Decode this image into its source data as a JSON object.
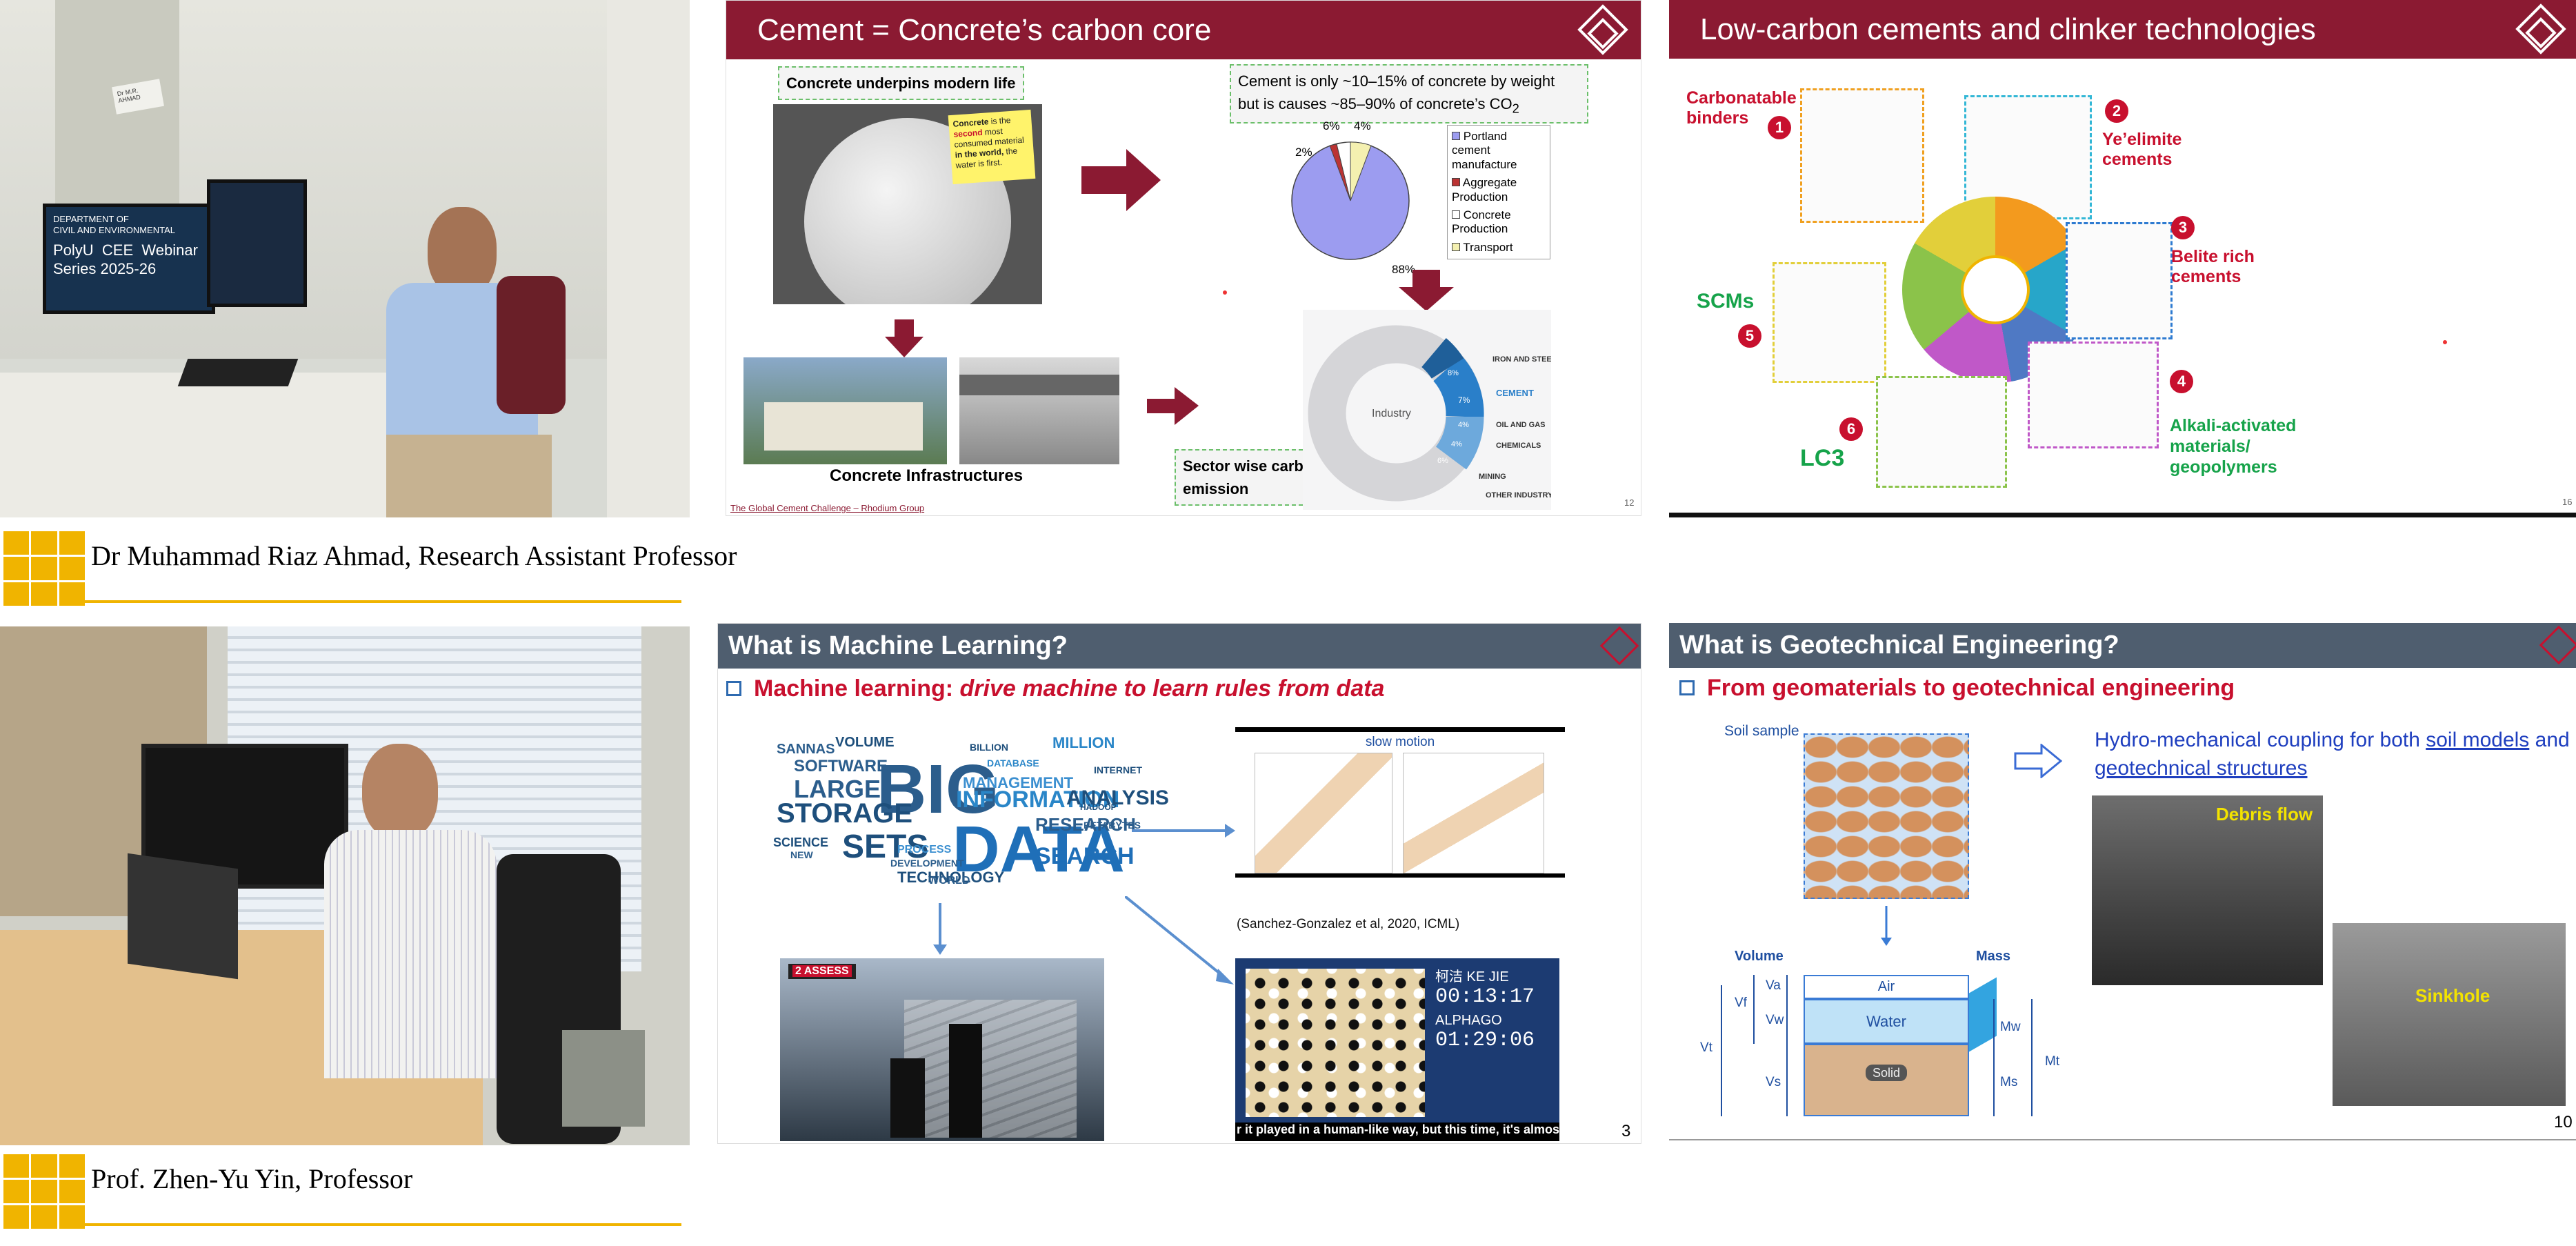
{
  "speakers": [
    {
      "name": "Dr Muhammad Riaz Ahmad, Research Assistant Professor"
    },
    {
      "name": "Prof. Zhen-Yu Yin, Professor"
    }
  ],
  "photo1": {
    "monitor_lines": [
      "DEPARTMENT OF",
      "CIVIL AND ENVIRONMENTAL",
      "PolyU",
      "CEE",
      "Webinar",
      "Series 2025-26"
    ],
    "nameplate": "Dr M.R. AHMAD"
  },
  "slide1": {
    "title": "Cement = Concrete’s carbon core",
    "box_concrete": "Concrete underpins modern life",
    "sticky": [
      "Concrete",
      "is the",
      "second",
      "most",
      "consumed material",
      "in the world,",
      "the",
      "water is first."
    ],
    "box_cement_l1": "Cement is only ~10–15% of concrete by weight",
    "box_cement_l2": "but is causes ~85–90% of concrete’s CO",
    "box_cement_sub": "2",
    "legend": [
      "Portland cement manufacture",
      "Aggregate Production",
      "Concrete Production",
      "Transport"
    ],
    "pie_labels": [
      "6%",
      "4%",
      "2%",
      "88%"
    ],
    "infra_label": "Concrete Infrastructures",
    "sector_l1": "Sector  wise  carbon",
    "sector_l2": "emission",
    "donut_labels": [
      "Industry",
      "IRON AND STEEL",
      "CEMENT",
      "OIL AND GAS",
      "CHEMICALS",
      "MINING",
      "OTHER INDUSTRY",
      "8%",
      "7%",
      "4%",
      "4%",
      "6%"
    ],
    "footer_source": "The Global Cement Challenge – Rhodium Group",
    "page": "12",
    "colors": {
      "title_bar": "#8b1a32",
      "pie_main": "#9c9cf0",
      "sticky": "#fff36b"
    }
  },
  "slide2": {
    "title": "Low-carbon cements and clinker technologies",
    "labels": {
      "l1": "Carbonatable binders",
      "l2": "Ye’elimite cements",
      "l3": "Belite rich cements",
      "l4": "Alkali-activated materials/ geopolymers",
      "l5": "SCMs",
      "l6": "LC3"
    },
    "numbers": [
      "1",
      "2",
      "3",
      "4",
      "5",
      "6"
    ],
    "page": "16"
  },
  "slide3": {
    "title": "What is Machine Learning?",
    "subtitle_prefix": "Machine learning: ",
    "subtitle_em": "drive machine to learn rules from data",
    "wordcloud": [
      "BIG",
      "DATA",
      "INFORMATION",
      "STORAGE",
      "LARGE",
      "SETS",
      "ANALYSIS",
      "SEARCH",
      "RESEARCH",
      "MANAGEMENT",
      "SOFTWARE",
      "VOLUME",
      "PROCESS",
      "DEVELOPMENT",
      "TECHNOLOGY",
      "NEW",
      "SCIENCE",
      "MILLION",
      "PETABYTES",
      "INTERNET",
      "WORLD",
      "BILLION",
      "DATABASE",
      "HADOOP",
      "SANNAS"
    ],
    "slow_motion": "slow motion",
    "citation": "(Sanchez-Gonzalez et al, 2020, ICML)",
    "assess_badge": "2 ASSESS",
    "go_player1": "柯洁 KE JIE",
    "go_time1": "00:13:17",
    "go_player2": "ALPHAGO",
    "go_time2": "01:29:06",
    "caption": "r it played in a human-like way, but this time, it's almost like th",
    "page": "3"
  },
  "slide4": {
    "title": "What is Geotechnical Engineering?",
    "subtitle": "From geomaterials to geotechnical engineering",
    "soil_sample": "Soil sample",
    "hydro_prefix": "Hydro-mechanical coupling for both ",
    "hydro_link1": "soil models",
    "hydro_and": " and ",
    "hydro_link2": "geotechnical structures",
    "debris": "Debris flow",
    "sinkhole": "Sinkhole",
    "phase": {
      "volume": "Volume",
      "mass": "Mass",
      "air": "Air",
      "water": "Water",
      "solid": "Solid",
      "va": "Va",
      "vw": "Vw",
      "vs": "Vs",
      "vf": "Vf",
      "vt": "Vt",
      "mw": "Mw",
      "ms": "Ms",
      "mt": "Mt"
    },
    "page": "10"
  }
}
